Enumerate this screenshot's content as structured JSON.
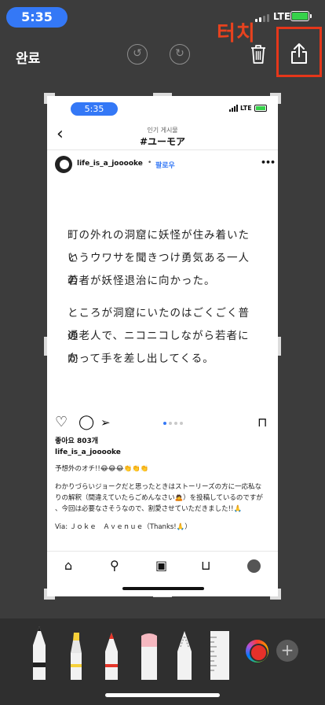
{
  "status_bar": {
    "time": "5:35",
    "network": "LTE",
    "battery_color": "#36d24a"
  },
  "toolbar": {
    "done_label": "완료",
    "undo_icon": "undo-icon",
    "redo_icon": "redo-icon",
    "trash_icon": "trash-icon",
    "share_icon": "share-icon",
    "touch_annotation": "터치",
    "annotation_color": "#e5361a"
  },
  "screenshot": {
    "status_time": "5:35",
    "status_network": "LTE",
    "header_subtitle": "인기 게시물",
    "header_title": "#ユーモア",
    "username": "life_is_a_jooooke",
    "follow_label": "팔로우",
    "post_lines": [
      "町の外れの洞窟に妖怪が住み着いたと",
      "いうウワサを聞きつけ勇気ある一人の",
      "若者が妖怪退治に向かった。",
      "ところが洞窟にいたのはごくごく普通",
      "の老人で、ニコニコしながら若者に向",
      "かって手を差し出してくる。"
    ],
    "likes": "좋아요 803개",
    "caption_username": "life_is_a_jooooke",
    "caption_lines": [
      "予想外のオチ!!😂😂😂👏👏👏",
      "わかりづらいジョークだと思ったときはストーリーズの方に一応私な",
      "りの解釈（間違えていたらごめんなさい🙇）を投稿しているのですが",
      "、今回は必要なさそうなので、割愛させていただきました!!🙏",
      "Via: Ｊｏｋｅ　Ａｖｅｎｕｅ（Thanks!🙏）"
    ]
  },
  "tools": [
    "pen",
    "highlighter",
    "pencil",
    "eraser",
    "lasso",
    "ruler"
  ]
}
